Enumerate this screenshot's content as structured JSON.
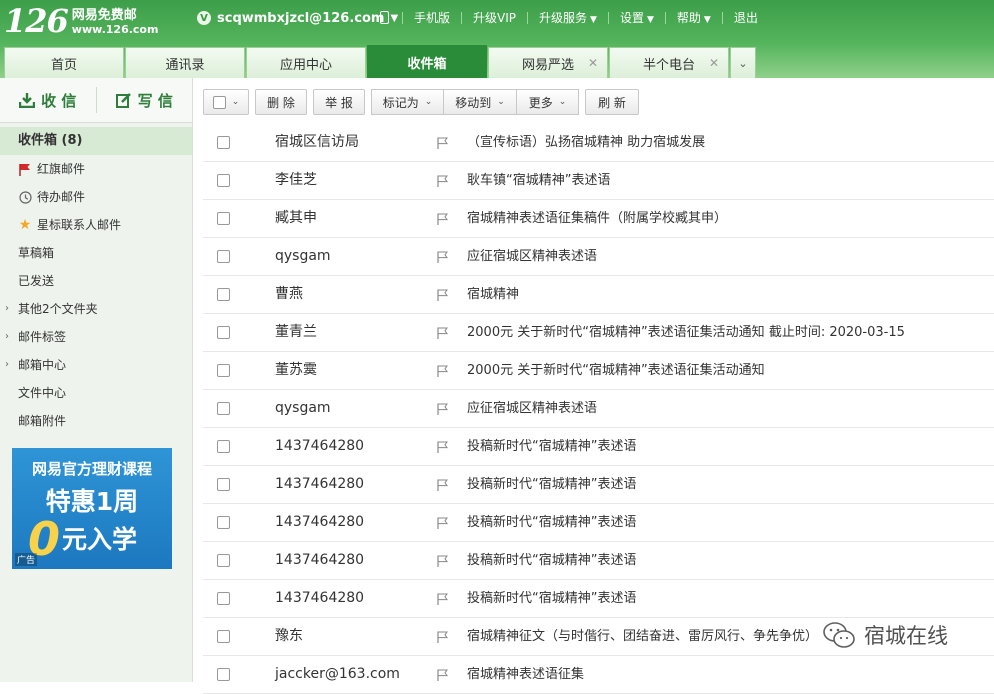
{
  "brand": {
    "number": "126",
    "name": "网易免费邮",
    "url": "www.126.com"
  },
  "account": {
    "badge": "V",
    "email": "scqwmbxjzcl@126.com"
  },
  "top_nav": [
    {
      "label": "手机版",
      "has_dropdown": false,
      "icon": "phone-icon"
    },
    {
      "label": "升级VIP",
      "has_dropdown": false
    },
    {
      "label": "升级服务",
      "has_dropdown": true
    },
    {
      "label": "设置",
      "has_dropdown": true
    },
    {
      "label": "帮助",
      "has_dropdown": true
    },
    {
      "label": "退出",
      "has_dropdown": false
    }
  ],
  "tabs": [
    {
      "label": "首页",
      "active": false,
      "closable": false
    },
    {
      "label": "通讯录",
      "active": false,
      "closable": false
    },
    {
      "label": "应用中心",
      "active": false,
      "closable": false
    },
    {
      "label": "收件箱",
      "active": true,
      "closable": false
    },
    {
      "label": "网易严选",
      "active": false,
      "closable": true
    },
    {
      "label": "半个电台",
      "active": false,
      "closable": true
    }
  ],
  "compose": {
    "receive": "收 信",
    "write": "写 信"
  },
  "folders": [
    {
      "label": "收件箱 (8)",
      "active": true
    },
    {
      "label": "红旗邮件",
      "icon": "red-flag-icon"
    },
    {
      "label": "待办邮件",
      "icon": "clock-icon"
    },
    {
      "label": "星标联系人邮件",
      "icon": "star-icon"
    },
    {
      "label": "草稿箱"
    },
    {
      "label": "已发送"
    },
    {
      "label": "其他2个文件夹",
      "expandable": true
    },
    {
      "label": "邮件标签",
      "expandable": true
    },
    {
      "label": "邮箱中心",
      "expandable": true
    },
    {
      "label": "文件中心"
    },
    {
      "label": "邮箱附件"
    }
  ],
  "ad": {
    "line1": "网易官方理财课程",
    "line2": "特惠1周",
    "zero": "0",
    "line3": "元入学",
    "tag": "广告"
  },
  "toolbar": {
    "delete": "删 除",
    "report": "举 报",
    "mark_as": "标记为",
    "move_to": "移动到",
    "more": "更多",
    "refresh": "刷 新"
  },
  "mails": [
    {
      "sender": "宿城区信访局",
      "subject": "（宣传标语）弘扬宿城精神 助力宿城发展"
    },
    {
      "sender": "李佳芝",
      "subject": "耿车镇“宿城精神”表述语"
    },
    {
      "sender": "臧其申",
      "subject": "宿城精神表述语征集稿件（附属学校臧其申）"
    },
    {
      "sender": "qysgam",
      "subject": "应征宿城区精神表述语"
    },
    {
      "sender": "曹燕",
      "subject": "宿城精神"
    },
    {
      "sender": "董青兰",
      "subject": "2000元 关于新时代“宿城精神”表述语征集活动通知 截止时间: 2020-03-15"
    },
    {
      "sender": "董苏霙",
      "subject": "2000元 关于新时代“宿城精神”表述语征集活动通知"
    },
    {
      "sender": "qysgam",
      "subject": "应征宿城区精神表述语"
    },
    {
      "sender": "1437464280",
      "subject": "投稿新时代“宿城精神”表述语"
    },
    {
      "sender": "1437464280",
      "subject": "投稿新时代“宿城精神”表述语"
    },
    {
      "sender": "1437464280",
      "subject": "投稿新时代“宿城精神”表述语"
    },
    {
      "sender": "1437464280",
      "subject": "投稿新时代“宿城精神”表述语"
    },
    {
      "sender": "1437464280",
      "subject": "投稿新时代“宿城精神”表述语"
    },
    {
      "sender": "豫东",
      "subject": "宿城精神征文（与时偕行、团结奋进、雷厉风行、争先争优）"
    },
    {
      "sender": "jaccker@163.com",
      "subject": "宿城精神表述语征集"
    }
  ],
  "watermark": {
    "text": "宿城在线",
    "icon": "wechat-icon"
  }
}
